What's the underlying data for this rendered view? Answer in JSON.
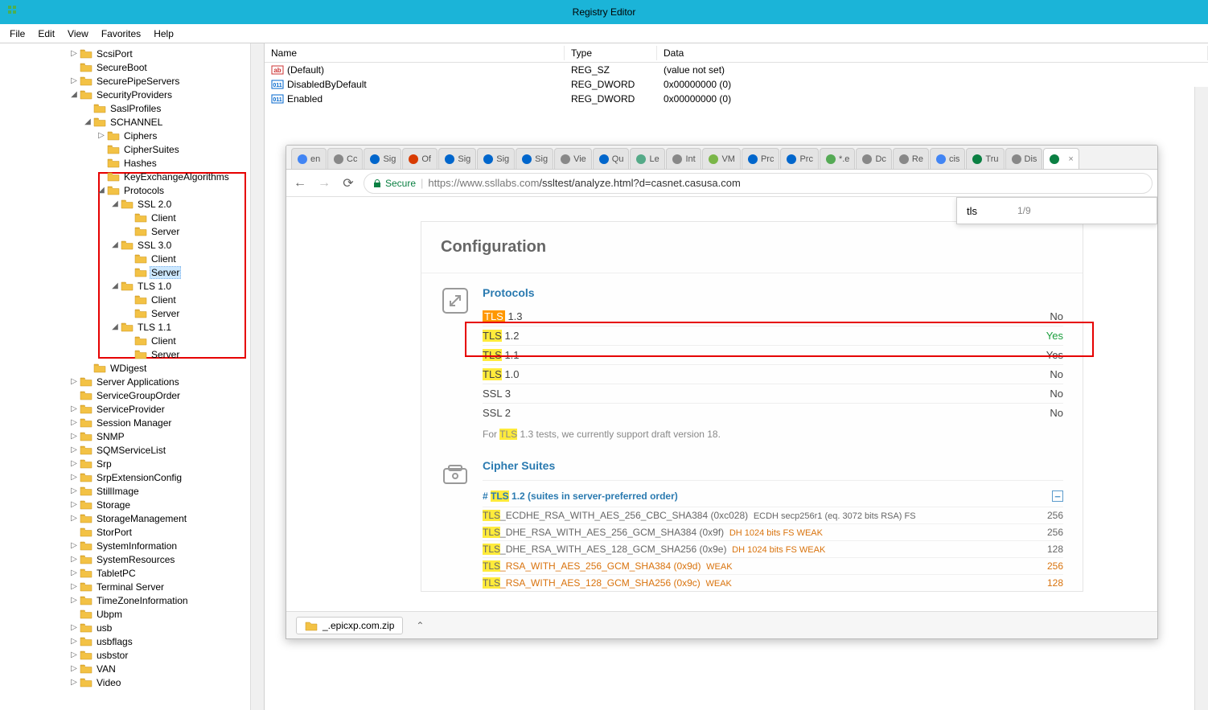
{
  "title": "Registry Editor",
  "menu": {
    "file": "File",
    "edit": "Edit",
    "view": "View",
    "favorites": "Favorites",
    "help": "Help"
  },
  "tree": [
    {
      "indent": 5,
      "exp": "▷",
      "label": "ScsiPort"
    },
    {
      "indent": 5,
      "exp": "",
      "label": "SecureBoot"
    },
    {
      "indent": 5,
      "exp": "▷",
      "label": "SecurePipeServers"
    },
    {
      "indent": 5,
      "exp": "◢",
      "label": "SecurityProviders"
    },
    {
      "indent": 6,
      "exp": "",
      "label": "SaslProfiles"
    },
    {
      "indent": 6,
      "exp": "◢",
      "label": "SCHANNEL"
    },
    {
      "indent": 7,
      "exp": "▷",
      "label": "Ciphers"
    },
    {
      "indent": 7,
      "exp": "",
      "label": "CipherSuites"
    },
    {
      "indent": 7,
      "exp": "",
      "label": "Hashes"
    },
    {
      "indent": 7,
      "exp": "",
      "label": "KeyExchangeAlgorithms"
    },
    {
      "indent": 7,
      "exp": "◢",
      "label": "Protocols"
    },
    {
      "indent": 8,
      "exp": "◢",
      "label": "SSL 2.0"
    },
    {
      "indent": 9,
      "exp": "",
      "label": "Client"
    },
    {
      "indent": 9,
      "exp": "",
      "label": "Server"
    },
    {
      "indent": 8,
      "exp": "◢",
      "label": "SSL 3.0"
    },
    {
      "indent": 9,
      "exp": "",
      "label": "Client"
    },
    {
      "indent": 9,
      "exp": "",
      "label": "Server",
      "selected": true
    },
    {
      "indent": 8,
      "exp": "◢",
      "label": "TLS 1.0"
    },
    {
      "indent": 9,
      "exp": "",
      "label": "Client"
    },
    {
      "indent": 9,
      "exp": "",
      "label": "Server"
    },
    {
      "indent": 8,
      "exp": "◢",
      "label": "TLS 1.1"
    },
    {
      "indent": 9,
      "exp": "",
      "label": "Client"
    },
    {
      "indent": 9,
      "exp": "",
      "label": "Server"
    },
    {
      "indent": 6,
      "exp": "",
      "label": "WDigest"
    },
    {
      "indent": 5,
      "exp": "▷",
      "label": "Server Applications"
    },
    {
      "indent": 5,
      "exp": "",
      "label": "ServiceGroupOrder"
    },
    {
      "indent": 5,
      "exp": "▷",
      "label": "ServiceProvider"
    },
    {
      "indent": 5,
      "exp": "▷",
      "label": "Session Manager"
    },
    {
      "indent": 5,
      "exp": "▷",
      "label": "SNMP"
    },
    {
      "indent": 5,
      "exp": "▷",
      "label": "SQMServiceList"
    },
    {
      "indent": 5,
      "exp": "▷",
      "label": "Srp"
    },
    {
      "indent": 5,
      "exp": "▷",
      "label": "SrpExtensionConfig"
    },
    {
      "indent": 5,
      "exp": "▷",
      "label": "StillImage"
    },
    {
      "indent": 5,
      "exp": "▷",
      "label": "Storage"
    },
    {
      "indent": 5,
      "exp": "▷",
      "label": "StorageManagement"
    },
    {
      "indent": 5,
      "exp": "",
      "label": "StorPort"
    },
    {
      "indent": 5,
      "exp": "▷",
      "label": "SystemInformation"
    },
    {
      "indent": 5,
      "exp": "▷",
      "label": "SystemResources"
    },
    {
      "indent": 5,
      "exp": "▷",
      "label": "TabletPC"
    },
    {
      "indent": 5,
      "exp": "▷",
      "label": "Terminal Server"
    },
    {
      "indent": 5,
      "exp": "▷",
      "label": "TimeZoneInformation"
    },
    {
      "indent": 5,
      "exp": "",
      "label": "Ubpm"
    },
    {
      "indent": 5,
      "exp": "▷",
      "label": "usb"
    },
    {
      "indent": 5,
      "exp": "▷",
      "label": "usbflags"
    },
    {
      "indent": 5,
      "exp": "▷",
      "label": "usbstor"
    },
    {
      "indent": 5,
      "exp": "▷",
      "label": "VAN"
    },
    {
      "indent": 5,
      "exp": "▷",
      "label": "Video"
    }
  ],
  "list": {
    "header": {
      "name": "Name",
      "type": "Type",
      "data": "Data"
    },
    "rows": [
      {
        "icon": "ab",
        "name": "(Default)",
        "type": "REG_SZ",
        "data": "(value not set)"
      },
      {
        "icon": "01",
        "name": "DisabledByDefault",
        "type": "REG_DWORD",
        "data": "0x00000000 (0)"
      },
      {
        "icon": "01",
        "name": "Enabled",
        "type": "REG_DWORD",
        "data": "0x00000000 (0)"
      }
    ]
  },
  "browser": {
    "tabs": [
      "en",
      "Cc",
      "Sig",
      "Of",
      "Sig",
      "Sig",
      "Sig",
      "Vie",
      "Qu",
      "Le",
      "Int",
      "VM",
      "Prc",
      "Prc",
      "*.e",
      "Dc",
      "Re",
      "cis",
      "Tru",
      "Dis",
      ""
    ],
    "secure": "Secure",
    "urlHost": "https://www.ssllabs.com",
    "urlPath": "/ssltest/analyze.html?d=casnet.casusa.com",
    "find": {
      "query": "tls",
      "count": "1/9"
    },
    "download": "_.epicxp.com.zip"
  },
  "ssl": {
    "configTitle": "Configuration",
    "protocolsTitle": "Protocols",
    "rows": [
      {
        "name": "TLS 1.3",
        "val": "No",
        "hl": "orange"
      },
      {
        "name": "TLS 1.2",
        "val": "Yes",
        "hl": "yellow",
        "yes": true
      },
      {
        "name": "TLS 1.1",
        "val": "Yes",
        "hl": "yellow"
      },
      {
        "name": "TLS 1.0",
        "val": "No",
        "hl": "yellow"
      },
      {
        "name": "SSL 3",
        "val": "No"
      },
      {
        "name": "SSL 2",
        "val": "No"
      }
    ],
    "note1": "For ",
    "note2": " 1.3 tests, we currently support draft version 18.",
    "noteHL": "TLS",
    "cipherTitle": "Cipher Suites",
    "cipherSub1": "# ",
    "cipherSub2": " 1.2 (suites in server-preferred order)",
    "cipherSubHL": "TLS",
    "ciphers": [
      {
        "name": "_ECDHE_RSA_WITH_AES_256_CBC_SHA384 (0xc028)",
        "extra": "ECDH secp256r1 (eq. 3072 bits RSA)   FS",
        "bits": "256"
      },
      {
        "name": "_DHE_RSA_WITH_AES_256_GCM_SHA384 (0x9f)",
        "extra": "DH 1024 bits   FS   WEAK",
        "bits": "256",
        "weak": true
      },
      {
        "name": "_DHE_RSA_WITH_AES_128_GCM_SHA256 (0x9e)",
        "extra": "DH 1024 bits   FS   WEAK",
        "bits": "128",
        "weak": true
      },
      {
        "name": "_RSA_WITH_AES_256_GCM_SHA384 (0x9d)",
        "extra": "WEAK",
        "bits": "256",
        "weakAll": true
      },
      {
        "name": "_RSA_WITH_AES_128_GCM_SHA256 (0x9c)",
        "extra": "WEAK",
        "bits": "128",
        "weakAll": true
      }
    ]
  }
}
